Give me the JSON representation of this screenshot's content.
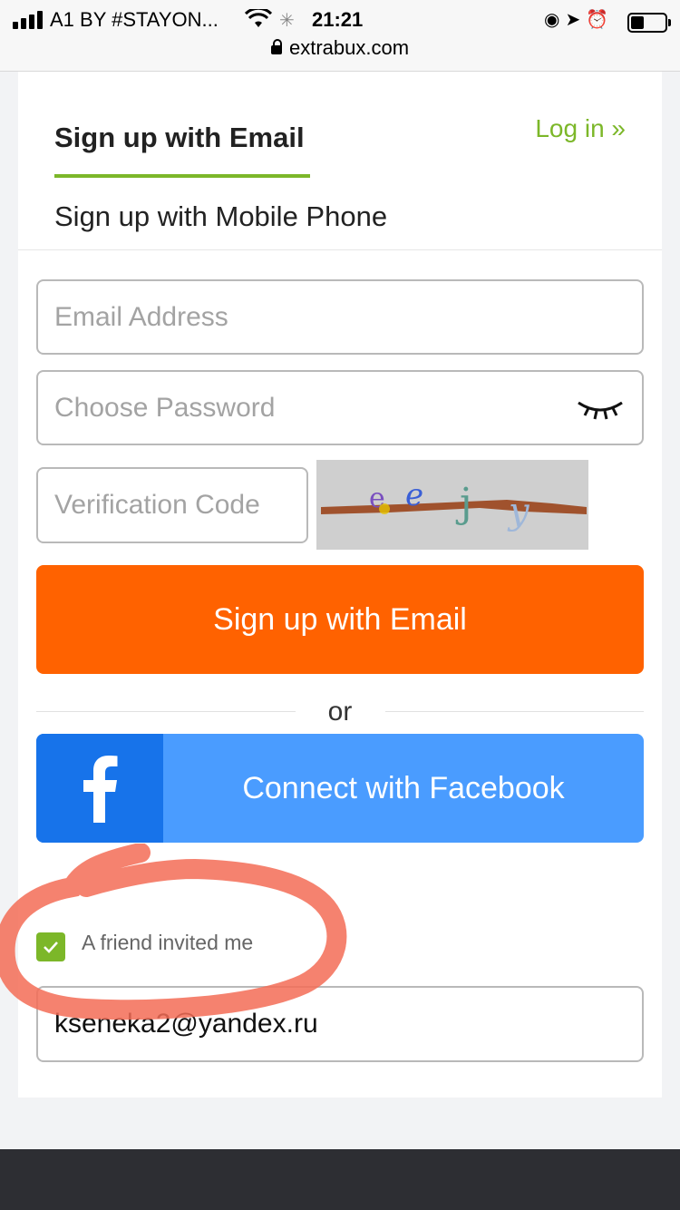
{
  "status_bar": {
    "carrier": "A1 BY #STAYON...",
    "time": "21:21",
    "url": "extrabux.com"
  },
  "tabs": {
    "email_tab": "Sign up with Email",
    "phone_tab": "Sign up with Mobile Phone",
    "login_link": "Log in »"
  },
  "form": {
    "email_placeholder": "Email Address",
    "password_placeholder": "Choose Password",
    "code_placeholder": "Verification Code",
    "signup_button": "Sign up with Email",
    "or_text": "or",
    "facebook_button": "Connect with Facebook",
    "invited_label": "A friend invited me",
    "invited_checked": true,
    "referrer_value": "kseneka2@yandex.ru"
  },
  "colors": {
    "accent_green": "#7cb729",
    "signup_orange": "#ff6200",
    "facebook_blue": "#4a9cff",
    "facebook_dark": "#1773ea",
    "annotation_red": "#f36c56"
  },
  "icons": [
    "lock-icon",
    "wifi-icon",
    "eye-closed-icon",
    "facebook-icon",
    "checkmark-icon"
  ]
}
